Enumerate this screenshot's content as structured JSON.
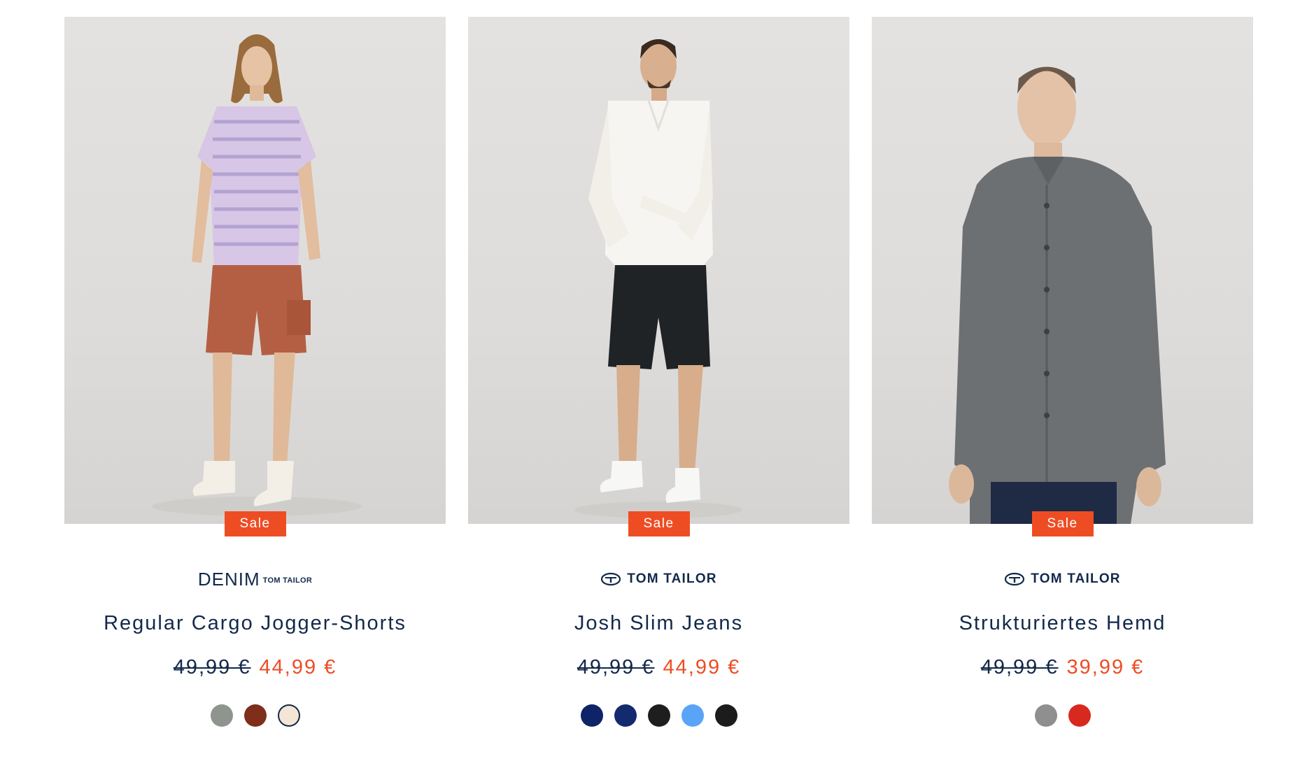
{
  "products": [
    {
      "badge": "Sale",
      "brand_type": "denim",
      "brand_big": "DENIM",
      "brand_small": "TOM TAILOR",
      "title": "Regular Cargo Jogger-Shorts",
      "old_price": "49,99 €",
      "new_price": "44,99 €",
      "swatches": [
        "#8e948e",
        "#7e2e1a",
        "#f3e6d5"
      ],
      "image": "model-striped-tee-cargo-shorts"
    },
    {
      "badge": "Sale",
      "brand_type": "tomtailor",
      "brand_name": "TOM TAILOR",
      "title": "Josh Slim Jeans",
      "old_price": "49,99 €",
      "new_price": "44,99 €",
      "swatches": [
        "#0f2368",
        "#142a6e",
        "#1e1e1e",
        "#5aa4f7",
        "#1c1c1c"
      ],
      "image": "model-white-shirt-black-denim-shorts"
    },
    {
      "badge": "Sale",
      "brand_type": "tomtailor",
      "brand_name": "TOM TAILOR",
      "title": "Strukturiertes Hemd",
      "old_price": "49,99 €",
      "new_price": "39,99 €",
      "swatches": [
        "#8f8f8f",
        "#d8291f"
      ],
      "image": "model-grey-textured-shirt"
    }
  ]
}
